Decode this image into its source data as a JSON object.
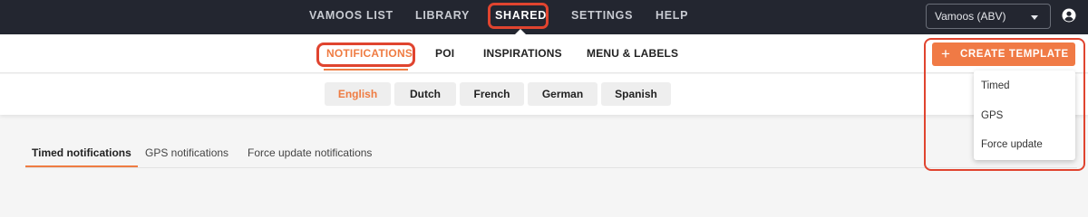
{
  "top_nav": {
    "items": [
      {
        "label": "VAMOOS LIST"
      },
      {
        "label": "LIBRARY"
      },
      {
        "label": "SHARED",
        "active": true
      },
      {
        "label": "SETTINGS"
      },
      {
        "label": "HELP"
      }
    ],
    "account_select": {
      "value": "Vamoos (ABV)"
    },
    "user_icon": "user-circle-icon"
  },
  "sub_nav": {
    "items": [
      {
        "label": "NOTIFICATIONS",
        "active": true
      },
      {
        "label": "POI"
      },
      {
        "label": "INSPIRATIONS"
      },
      {
        "label": "MENU & LABELS"
      }
    ]
  },
  "languages": {
    "items": [
      {
        "label": "English",
        "active": true
      },
      {
        "label": "Dutch"
      },
      {
        "label": "French"
      },
      {
        "label": "German"
      },
      {
        "label": "Spanish"
      }
    ]
  },
  "content_tabs": {
    "items": [
      {
        "label": "Timed notifications",
        "active": true
      },
      {
        "label": "GPS notifications"
      },
      {
        "label": "Force update notifications"
      }
    ]
  },
  "create_template": {
    "button_label": "CREATE TEMPLATE",
    "icon": "plus-icon",
    "menu": [
      "Timed",
      "GPS",
      "Force update"
    ]
  },
  "colors": {
    "topbar_bg": "#232630",
    "accent": "#ef7c43",
    "highlight": "#e0442f"
  }
}
